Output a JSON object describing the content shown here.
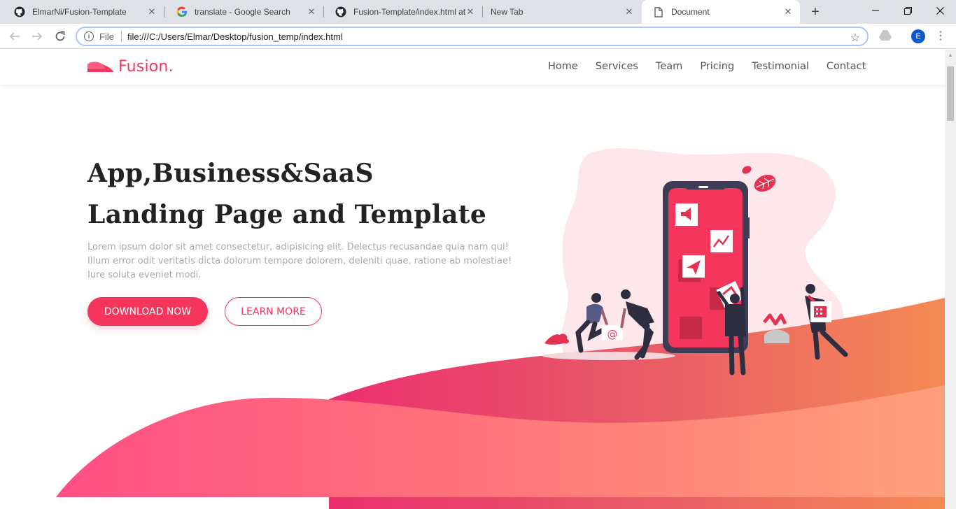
{
  "browser": {
    "tabs": [
      {
        "title": "ElmarNi/Fusion-Template",
        "icon": "github-icon"
      },
      {
        "title": "translate - Google Search",
        "icon": "google-icon"
      },
      {
        "title": "Fusion-Template/index.html at",
        "icon": "github-icon"
      },
      {
        "title": "New Tab",
        "icon": "none"
      },
      {
        "title": "Document",
        "icon": "document-icon",
        "active": true
      }
    ],
    "address": {
      "scheme_label": "File",
      "url": "file:///C:/Users/Elmar/Desktop/fusion_temp/index.html"
    },
    "profile_initial": "E"
  },
  "site": {
    "brand": "Fusion.",
    "brand_color": "#f5365c",
    "nav": [
      "Home",
      "Services",
      "Team",
      "Pricing",
      "Testimonial",
      "Contact"
    ],
    "hero": {
      "title_line1": "App,Business&SaaS",
      "title_line2": "Landing Page and Template",
      "text": "Lorem ipsum dolor sit amet consectetur, adipisicing elit. Delectus recusandae quia nam qui! Illum error odit veritatis dicta dolorum tempore dolorem, deleniti quae, ratione ab molestiae! Iure soluta eveniet modi.",
      "primary_button": "DOWNLOAD NOW",
      "secondary_button": "LEARN MORE"
    }
  }
}
